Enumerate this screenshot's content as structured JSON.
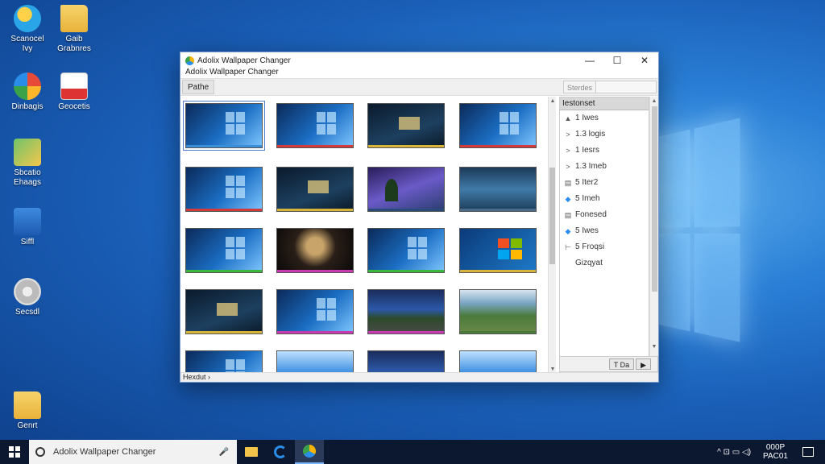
{
  "desktop": {
    "icons": [
      {
        "label": "Scanocel\nIvy",
        "icon": "globe-icon"
      },
      {
        "label": "Gaib\nGrabnres",
        "icon": "folder-icon"
      },
      {
        "label": "Dinbagis",
        "icon": "pie-icon"
      },
      {
        "label": "Geocetis",
        "icon": "document-icon"
      },
      {
        "label": "Sbcatio\nEhaags",
        "icon": "chart-icon"
      },
      {
        "label": "Siffl",
        "icon": "music-icon"
      },
      {
        "label": "Secsdl",
        "icon": "disc-icon"
      },
      {
        "label": "Genrt",
        "icon": "folder-icon"
      }
    ]
  },
  "window": {
    "title": "Adolix Wallpaper Changer",
    "subtitle": "Adolix Wallpaper Changer",
    "tab_label": "Pathe",
    "search_label": "Sterdes",
    "search_value": "",
    "status_text": "Hexdut ›",
    "thumbnails": [
      {
        "style": "th-win",
        "stripe": "#3a8fd8",
        "selected": true
      },
      {
        "style": "th-win",
        "stripe": "#d43a3a",
        "selected": false
      },
      {
        "style": "th-dark",
        "stripe": "#d8b43a",
        "selected": false
      },
      {
        "style": "th-win",
        "stripe": "#d43a3a",
        "selected": false
      },
      {
        "style": "th-win",
        "stripe": "#d43a3a",
        "selected": false
      },
      {
        "style": "th-dark",
        "stripe": "#d8b43a",
        "selected": false
      },
      {
        "style": "th-purple",
        "stripe": "#2a4a7a",
        "selected": false
      },
      {
        "style": "th-lake",
        "stripe": "#4a6a8a",
        "selected": false
      },
      {
        "style": "th-win",
        "stripe": "#3ab83a",
        "selected": false
      },
      {
        "style": "th-room",
        "stripe": "#c83ab0",
        "selected": false
      },
      {
        "style": "th-win",
        "stripe": "#3ab83a",
        "selected": false
      },
      {
        "style": "th-flag",
        "stripe": "#d8b43a",
        "selected": false
      },
      {
        "style": "th-dark",
        "stripe": "#d8b43a",
        "selected": false
      },
      {
        "style": "th-win",
        "stripe": "#c83ab0",
        "selected": false
      },
      {
        "style": "th-night",
        "stripe": "#c83ab0",
        "selected": false
      },
      {
        "style": "th-green",
        "stripe": "#4a7a3a",
        "selected": false
      },
      {
        "style": "th-win",
        "stripe": "#3a8fd8",
        "selected": false
      },
      {
        "style": "th-sky",
        "stripe": "#4a7a3a",
        "selected": false
      },
      {
        "style": "th-night",
        "stripe": "#4a7a3a",
        "selected": false
      },
      {
        "style": "th-sky",
        "stripe": "#4a7a3a",
        "selected": false
      }
    ],
    "side_panel": {
      "header": "Iestonset",
      "items": [
        {
          "icon": "▲",
          "label": "1 Iwes",
          "diamond": false
        },
        {
          "icon": ">",
          "label": "1.3 logis",
          "diamond": false
        },
        {
          "icon": ">",
          "label": "1 Iesrs",
          "diamond": false
        },
        {
          "icon": ">",
          "label": "1.3 Imeb",
          "diamond": false
        },
        {
          "icon": "▤",
          "label": "5 Iter2",
          "diamond": false
        },
        {
          "icon": "◆",
          "label": "5 Imeh",
          "diamond": true
        },
        {
          "icon": "▤",
          "label": "Fonesed",
          "diamond": false
        },
        {
          "icon": "◆",
          "label": "5 Iwes",
          "diamond": true
        },
        {
          "icon": "⊢",
          "label": "5 Froqsi",
          "diamond": false
        },
        {
          "icon": "",
          "label": "Gizqyat",
          "diamond": false
        }
      ],
      "footer_btn1": "T  Da",
      "footer_btn2": "▶"
    }
  },
  "taskbar": {
    "search_text": "Adolix Wallpaper Changer",
    "time": "000P",
    "date": "PAC01",
    "tray_icons": "^  ⊡  ▭  ◁)"
  },
  "colors": {
    "accent": "#2a8de8",
    "taskbar": "#0b1830"
  }
}
